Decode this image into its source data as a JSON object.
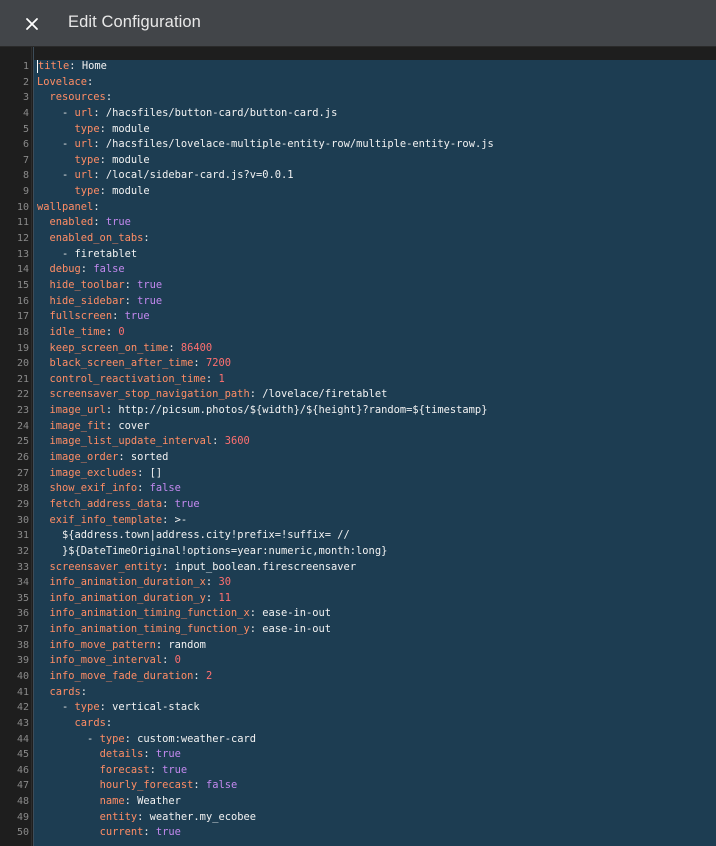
{
  "dialog": {
    "title": "Edit Configuration",
    "close_icon": "close-icon"
  },
  "colors": {
    "titlebar": "#424549",
    "editor_bg": "#1e1e1e",
    "selection": "#1d3d52",
    "key": "#ff8d65",
    "boolean": "#c389ef",
    "number": "#ff7070"
  },
  "editor": {
    "lines": [
      {
        "indent": "",
        "dash": false,
        "key": "title",
        "value": "Home",
        "type": "string"
      },
      {
        "indent": "",
        "dash": false,
        "key": "Lovelace",
        "value": "",
        "type": "none"
      },
      {
        "indent": "  ",
        "dash": false,
        "key": "resources",
        "value": "",
        "type": "none"
      },
      {
        "indent": "    ",
        "dash": true,
        "key": "url",
        "value": "/hacsfiles/button-card/button-card.js",
        "type": "string"
      },
      {
        "indent": "      ",
        "dash": false,
        "key": "type",
        "value": "module",
        "type": "string"
      },
      {
        "indent": "    ",
        "dash": true,
        "key": "url",
        "value": "/hacsfiles/lovelace-multiple-entity-row/multiple-entity-row.js",
        "type": "string"
      },
      {
        "indent": "      ",
        "dash": false,
        "key": "type",
        "value": "module",
        "type": "string"
      },
      {
        "indent": "    ",
        "dash": true,
        "key": "url",
        "value": "/local/sidebar-card.js?v=0.0.1",
        "type": "string"
      },
      {
        "indent": "      ",
        "dash": false,
        "key": "type",
        "value": "module",
        "type": "string"
      },
      {
        "indent": "",
        "dash": false,
        "key": "wallpanel",
        "value": "",
        "type": "none"
      },
      {
        "indent": "  ",
        "dash": false,
        "key": "enabled",
        "value": "true",
        "type": "boolean"
      },
      {
        "indent": "  ",
        "dash": false,
        "key": "enabled_on_tabs",
        "value": "",
        "type": "none"
      },
      {
        "indent": "    ",
        "dash": true,
        "key": "",
        "value": "firetablet",
        "type": "string"
      },
      {
        "indent": "  ",
        "dash": false,
        "key": "debug",
        "value": "false",
        "type": "boolean"
      },
      {
        "indent": "  ",
        "dash": false,
        "key": "hide_toolbar",
        "value": "true",
        "type": "boolean"
      },
      {
        "indent": "  ",
        "dash": false,
        "key": "hide_sidebar",
        "value": "true",
        "type": "boolean"
      },
      {
        "indent": "  ",
        "dash": false,
        "key": "fullscreen",
        "value": "true",
        "type": "boolean"
      },
      {
        "indent": "  ",
        "dash": false,
        "key": "idle_time",
        "value": "0",
        "type": "number"
      },
      {
        "indent": "  ",
        "dash": false,
        "key": "keep_screen_on_time",
        "value": "86400",
        "type": "number"
      },
      {
        "indent": "  ",
        "dash": false,
        "key": "black_screen_after_time",
        "value": "7200",
        "type": "number"
      },
      {
        "indent": "  ",
        "dash": false,
        "key": "control_reactivation_time",
        "value": "1",
        "type": "number"
      },
      {
        "indent": "  ",
        "dash": false,
        "key": "screensaver_stop_navigation_path",
        "value": "/lovelace/firetablet",
        "type": "string"
      },
      {
        "indent": "  ",
        "dash": false,
        "key": "image_url",
        "value": "http://picsum.photos/${width}/${height}?random=${timestamp}",
        "type": "string"
      },
      {
        "indent": "  ",
        "dash": false,
        "key": "image_fit",
        "value": "cover",
        "type": "string"
      },
      {
        "indent": "  ",
        "dash": false,
        "key": "image_list_update_interval",
        "value": "3600",
        "type": "number"
      },
      {
        "indent": "  ",
        "dash": false,
        "key": "image_order",
        "value": "sorted",
        "type": "string"
      },
      {
        "indent": "  ",
        "dash": false,
        "key": "image_excludes",
        "value": "[]",
        "type": "string"
      },
      {
        "indent": "  ",
        "dash": false,
        "key": "show_exif_info",
        "value": "false",
        "type": "boolean"
      },
      {
        "indent": "  ",
        "dash": false,
        "key": "fetch_address_data",
        "value": "true",
        "type": "boolean"
      },
      {
        "indent": "  ",
        "dash": false,
        "key": "exif_info_template",
        "value": ">-",
        "type": "string"
      },
      {
        "indent": "    ",
        "dash": false,
        "key": "",
        "value": "${address.town|address.city!prefix=!suffix= //",
        "type": "string"
      },
      {
        "indent": "    ",
        "dash": false,
        "key": "",
        "value": "}${DateTimeOriginal!options=year:numeric,month:long}",
        "type": "string"
      },
      {
        "indent": "  ",
        "dash": false,
        "key": "screensaver_entity",
        "value": "input_boolean.firescreensaver",
        "type": "string"
      },
      {
        "indent": "  ",
        "dash": false,
        "key": "info_animation_duration_x",
        "value": "30",
        "type": "number"
      },
      {
        "indent": "  ",
        "dash": false,
        "key": "info_animation_duration_y",
        "value": "11",
        "type": "number"
      },
      {
        "indent": "  ",
        "dash": false,
        "key": "info_animation_timing_function_x",
        "value": "ease-in-out",
        "type": "string"
      },
      {
        "indent": "  ",
        "dash": false,
        "key": "info_animation_timing_function_y",
        "value": "ease-in-out",
        "type": "string"
      },
      {
        "indent": "  ",
        "dash": false,
        "key": "info_move_pattern",
        "value": "random",
        "type": "string"
      },
      {
        "indent": "  ",
        "dash": false,
        "key": "info_move_interval",
        "value": "0",
        "type": "number"
      },
      {
        "indent": "  ",
        "dash": false,
        "key": "info_move_fade_duration",
        "value": "2",
        "type": "number"
      },
      {
        "indent": "  ",
        "dash": false,
        "key": "cards",
        "value": "",
        "type": "none"
      },
      {
        "indent": "    ",
        "dash": true,
        "key": "type",
        "value": "vertical-stack",
        "type": "string"
      },
      {
        "indent": "      ",
        "dash": false,
        "key": "cards",
        "value": "",
        "type": "none"
      },
      {
        "indent": "        ",
        "dash": true,
        "key": "type",
        "value": "custom:weather-card",
        "type": "string"
      },
      {
        "indent": "          ",
        "dash": false,
        "key": "details",
        "value": "true",
        "type": "boolean"
      },
      {
        "indent": "          ",
        "dash": false,
        "key": "forecast",
        "value": "true",
        "type": "boolean"
      },
      {
        "indent": "          ",
        "dash": false,
        "key": "hourly_forecast",
        "value": "false",
        "type": "boolean"
      },
      {
        "indent": "          ",
        "dash": false,
        "key": "name",
        "value": "Weather",
        "type": "string"
      },
      {
        "indent": "          ",
        "dash": false,
        "key": "entity",
        "value": "weather.my_ecobee",
        "type": "string"
      },
      {
        "indent": "          ",
        "dash": false,
        "key": "current",
        "value": "true",
        "type": "boolean"
      }
    ]
  }
}
